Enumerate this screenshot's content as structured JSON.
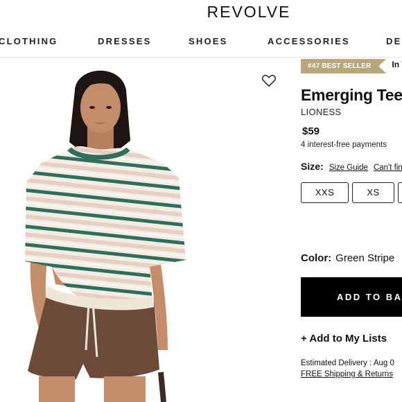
{
  "header": {
    "logo": "REVOLVE"
  },
  "nav": {
    "items": [
      {
        "label": "CLOTHING"
      },
      {
        "label": "DRESSES"
      },
      {
        "label": "SHOES"
      },
      {
        "label": "ACCESSORIES"
      },
      {
        "label": "DES"
      }
    ]
  },
  "product": {
    "badge": "#47 BEST SELLER",
    "badge_category": "In Tops",
    "title": "Emerging Tee",
    "brand": "LIONESS",
    "price": "$59",
    "installments": "4 interest-free payments",
    "size_label": "Size:",
    "size_guide": "Size Guide",
    "cant_find": "Can't find",
    "sizes": [
      {
        "label": "XXS"
      },
      {
        "label": "XS"
      },
      {
        "label": ""
      }
    ],
    "color_label": "Color:",
    "color_value": "Green Stripe",
    "add_to_bag": "ADD TO BAG",
    "add_to_lists": "+ Add to My Lists",
    "delivery": "Estimated Delivery : Aug 0",
    "shipping": "FREE Shipping & Returns"
  },
  "colors": {
    "badge_bg": "#b8a77c",
    "stripe_green": "#2f6e5a",
    "stripe_pink": "#e8cfc4",
    "shorts_brown": "#6b4a3a",
    "button_black": "#000000"
  },
  "icons": {
    "favorite": "heart-outline-icon"
  }
}
